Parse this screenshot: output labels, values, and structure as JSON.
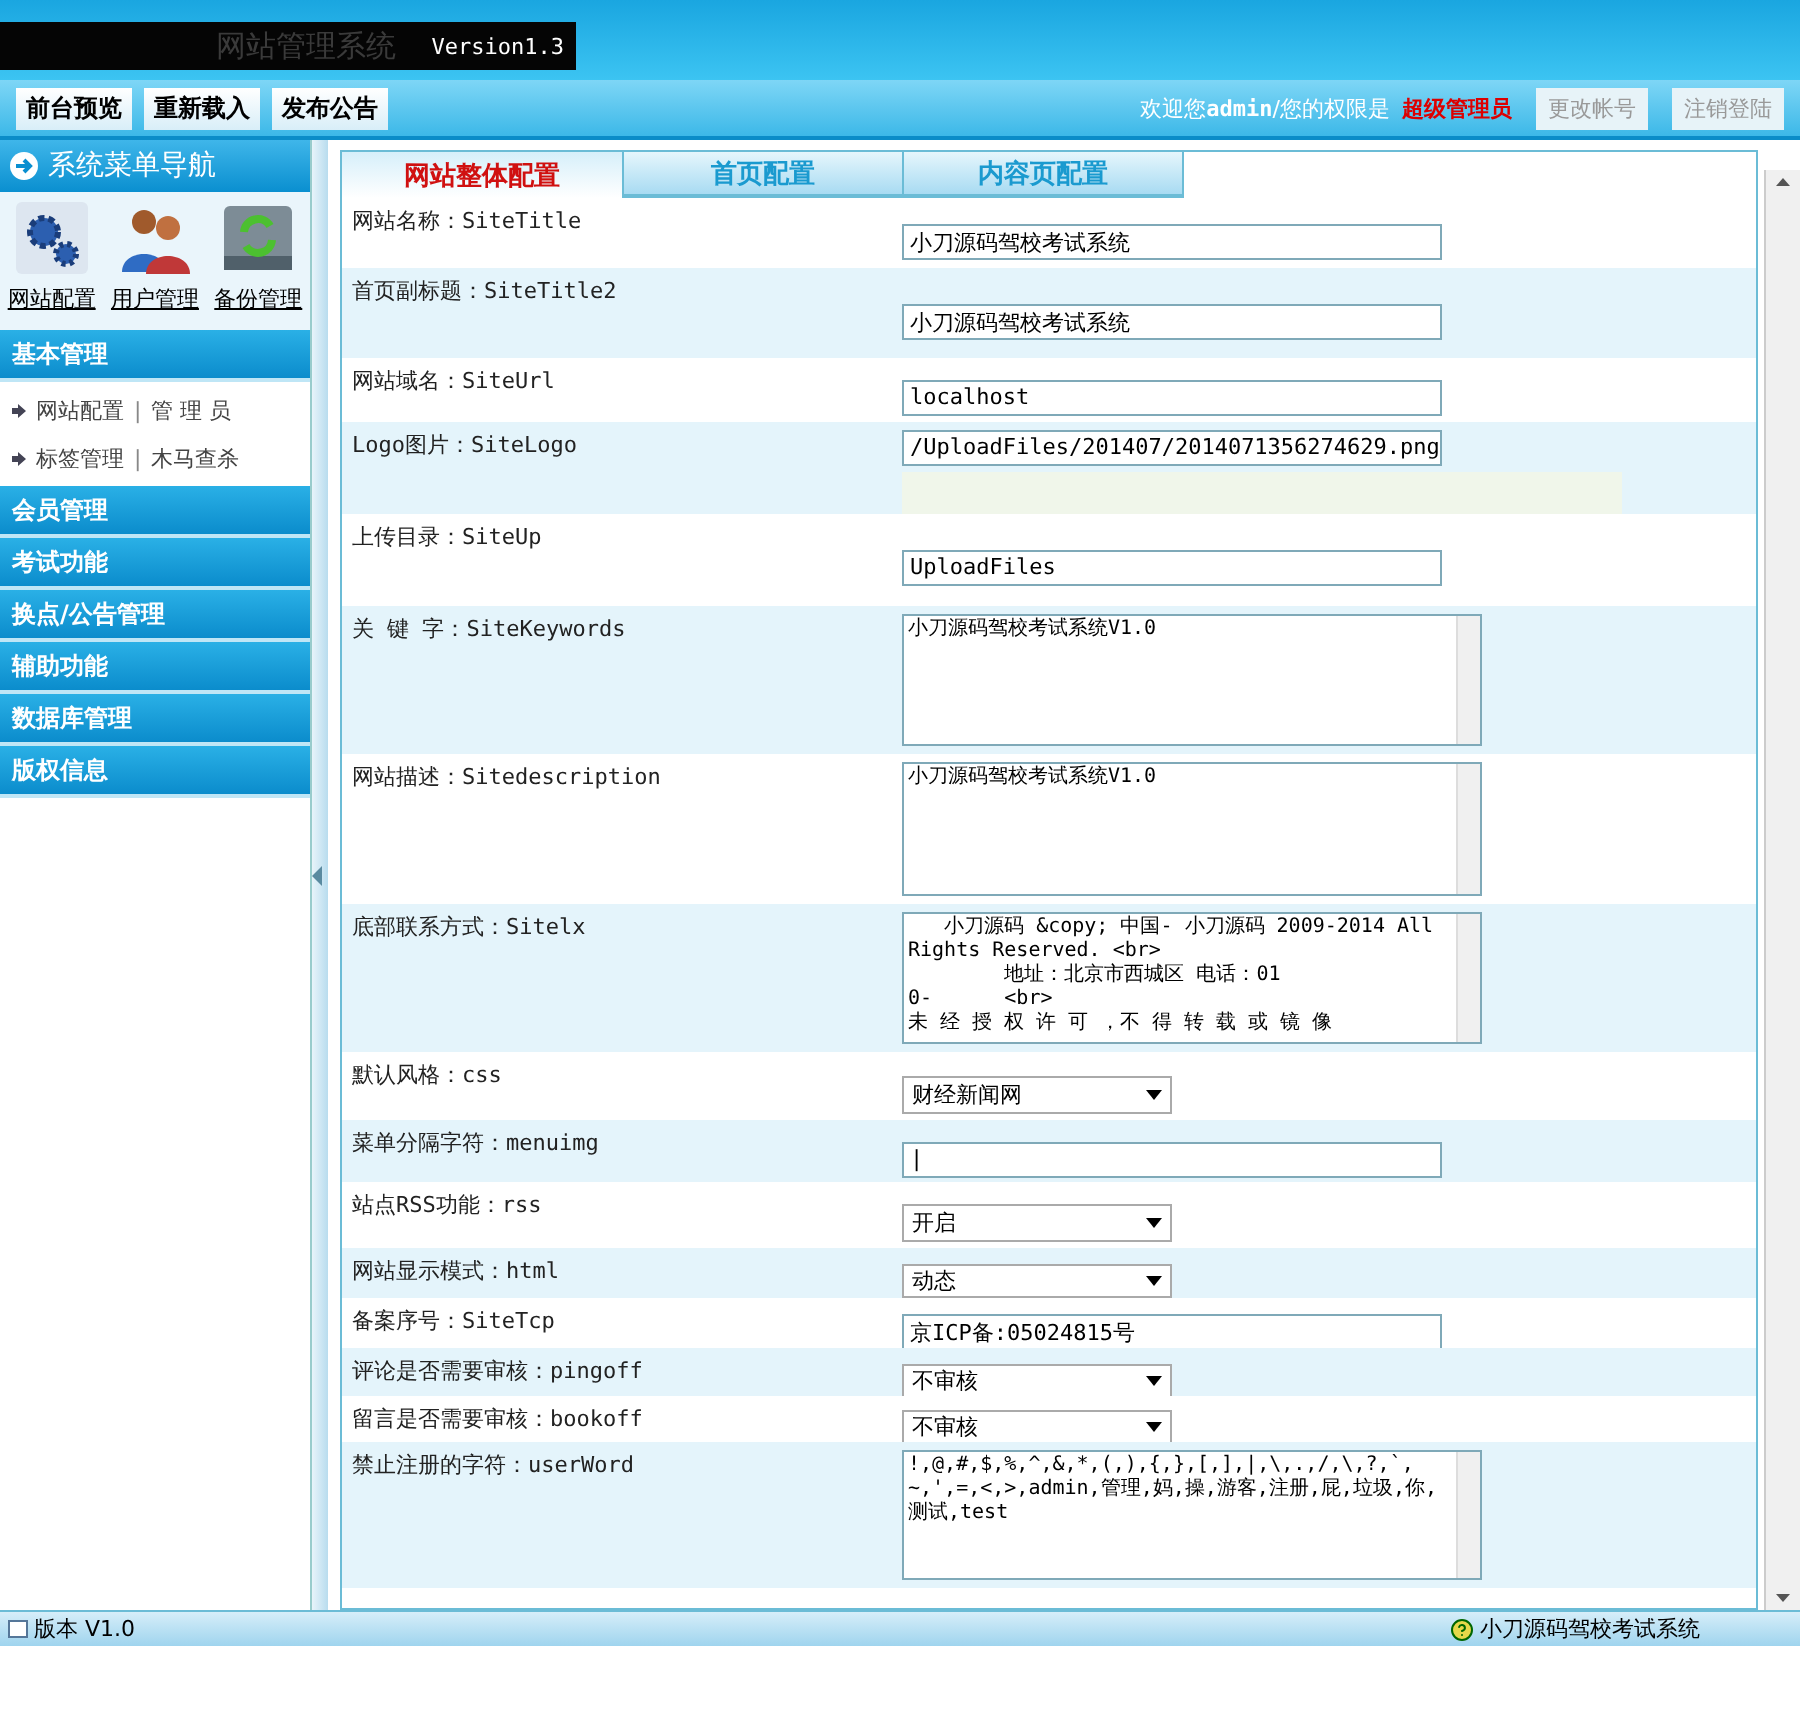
{
  "header": {
    "title": "网站管理系统",
    "version": "Version1.3"
  },
  "toolbar": {
    "buttons": [
      "前台预览",
      "重新载入",
      "发布公告"
    ],
    "welcome": "欢迎您**admin**/您的权限是",
    "role": "超级管理员",
    "actions": [
      "更改帐号",
      "注销登陆"
    ]
  },
  "sidebar": {
    "title": "系统菜单导航",
    "shortcuts": [
      {
        "kind": "settings",
        "label": "网站配置"
      },
      {
        "kind": "users",
        "label": "用户管理"
      },
      {
        "kind": "backup",
        "label": "备份管理"
      }
    ],
    "sections": [
      {
        "label": "基本管理",
        "expanded": true,
        "items": [
          {
            "links": [
              "网站配置",
              "管 理 员"
            ],
            "separator": "|"
          },
          {
            "links": [
              "标签管理",
              "木马查杀"
            ],
            "separator": "|"
          }
        ]
      },
      {
        "label": "会员管理"
      },
      {
        "label": "考试功能"
      },
      {
        "label": "换点/公告管理"
      },
      {
        "label": "辅助功能"
      },
      {
        "label": "数据库管理"
      },
      {
        "label": "版权信息"
      }
    ]
  },
  "tabs": [
    {
      "label": "网站整体配置",
      "selected": true
    },
    {
      "label": "首页配置",
      "selected": false
    },
    {
      "label": "内容页配置",
      "selected": false
    }
  ],
  "form": [
    {
      "kind": "text",
      "label": "网站名称：SiteTitle",
      "value": "小刀源码驾校考试系统"
    },
    {
      "kind": "text",
      "label": "首页副标题：SiteTitle2",
      "value": "小刀源码驾校考试系统"
    },
    {
      "kind": "text",
      "label": "网站域名：SiteUrl",
      "value": "localhost"
    },
    {
      "kind": "logo",
      "label": "Logo图片：SiteLogo",
      "value": "/UploadFiles/201407/2014071356274629.png"
    },
    {
      "kind": "text",
      "label": "上传目录：SiteUp",
      "value": "UploadFiles"
    },
    {
      "kind": "textarea",
      "label": "关 键 字：SiteKeywords",
      "value": "小刀源码驾校考试系统V1.0"
    },
    {
      "kind": "textarea",
      "label": "网站描述：Sitedescription",
      "value": "小刀源码驾校考试系统V1.0"
    },
    {
      "kind": "textarea",
      "label": "底部联系方式：Sitelx",
      "value": "   小刀源码 &copy; 中国- 小刀源码 2009-2014 All Rights Reserved. <br>\n        地址：北京市西城区 电话：01\n0-      <br>\n未 经 授 权 许 可 ，不 得 转 载 或 镜 像"
    },
    {
      "kind": "select",
      "label": "默认风格：css",
      "value": "财经新闻网"
    },
    {
      "kind": "text",
      "label": "菜单分隔字符：menuimg",
      "value": "|"
    },
    {
      "kind": "select",
      "label": "站点RSS功能：rss",
      "value": "开启"
    },
    {
      "kind": "select",
      "label": "网站显示模式：html",
      "value": "动态"
    },
    {
      "kind": "text",
      "label": "备案序号：SiteTcp",
      "value": "京ICP备:05024815号"
    },
    {
      "kind": "select",
      "label": "评论是否需要审核：pingoff",
      "value": "不审核"
    },
    {
      "kind": "select",
      "label": "留言是否需要审核：bookoff",
      "value": "不审核"
    },
    {
      "kind": "textarea",
      "label": "禁止注册的字符：userWord",
      "value": "!,@,#,$,%,^,&,*,(,),{,},[,],|,\\,.,/,\\,?,`,~,',=,<,>,admin,管理,妈,操,游客,注册,屁,垃圾,你,测试,test"
    }
  ],
  "status_bar": {
    "version": "版本 V1.0",
    "app": "小刀源码驾校考试系统"
  }
}
